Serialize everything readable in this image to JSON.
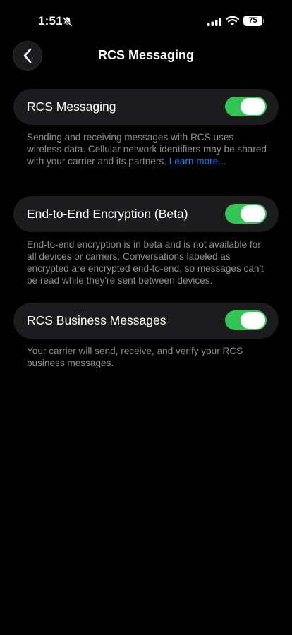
{
  "status_bar": {
    "time": "1:51",
    "battery_level": "75",
    "icons": [
      "bell-slash-icon",
      "cellular-signal-icon",
      "wifi-icon",
      "battery-icon"
    ]
  },
  "nav": {
    "title": "RCS Messaging",
    "back_icon": "chevron-left-icon"
  },
  "colors": {
    "background": "#000000",
    "cell_background": "#1c1c1e",
    "toggle_on": "#31c553",
    "footnote_text": "#8e8e93",
    "link": "#0a84ff"
  },
  "settings": [
    {
      "label": "RCS Messaging",
      "enabled": true,
      "footnote": "Sending and receiving messages with RCS uses wireless data. Cellular network identifiers may be shared with your carrier and its partners. ",
      "link": "Learn more..."
    },
    {
      "label": "End-to-End Encryption (Beta)",
      "enabled": true,
      "footnote": "End-to-end encryption is in beta and is not available for all devices or carriers. Conversations labeled as encrypted are encrypted end-to-end, so messages can't be read while they're sent between devices."
    },
    {
      "label": "RCS Business Messages",
      "enabled": true,
      "footnote": "Your carrier will send, receive, and verify your RCS business messages."
    }
  ]
}
